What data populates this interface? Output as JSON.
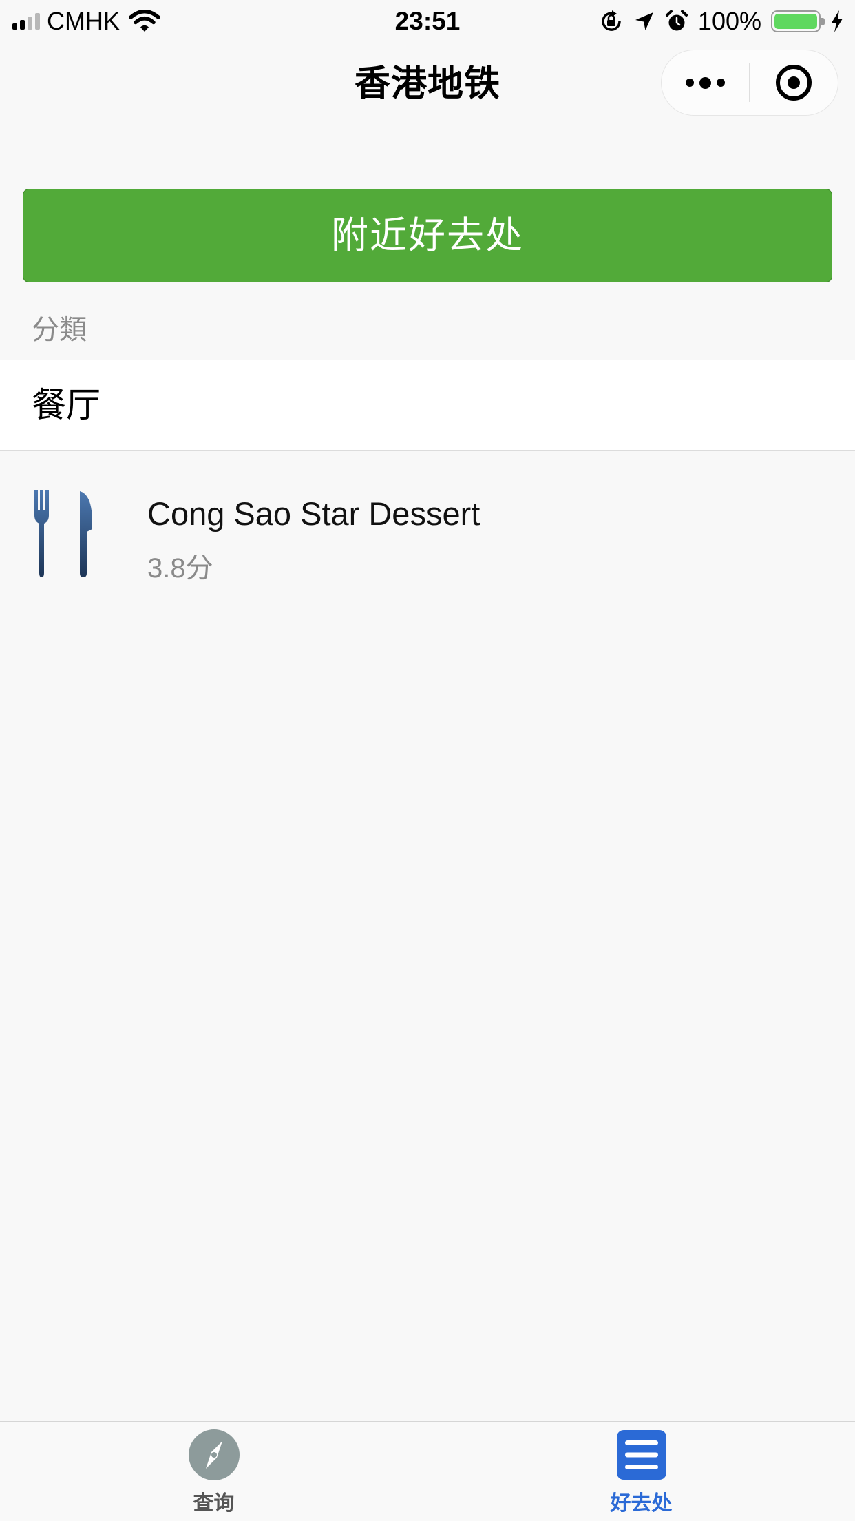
{
  "status_bar": {
    "carrier": "CMHK",
    "time": "23:51",
    "battery": "100%",
    "battery_level": 1.0,
    "battery_color": "#5fd85f"
  },
  "nav": {
    "title": "香港地铁"
  },
  "nearby_button": {
    "label": "附近好去处",
    "color": "#52aa39"
  },
  "category": {
    "section_label": "分類",
    "selected": "餐厅"
  },
  "places": [
    {
      "name": "Cong Sao Star Dessert",
      "score": "3.8分",
      "icon": "fork-knife-icon"
    }
  ],
  "tab_bar": {
    "tabs": [
      {
        "label": "查询",
        "icon": "compass-icon",
        "active": false,
        "color": "#555555"
      },
      {
        "label": "好去处",
        "icon": "list-icon",
        "active": true,
        "color": "#2b6ad6"
      }
    ]
  }
}
